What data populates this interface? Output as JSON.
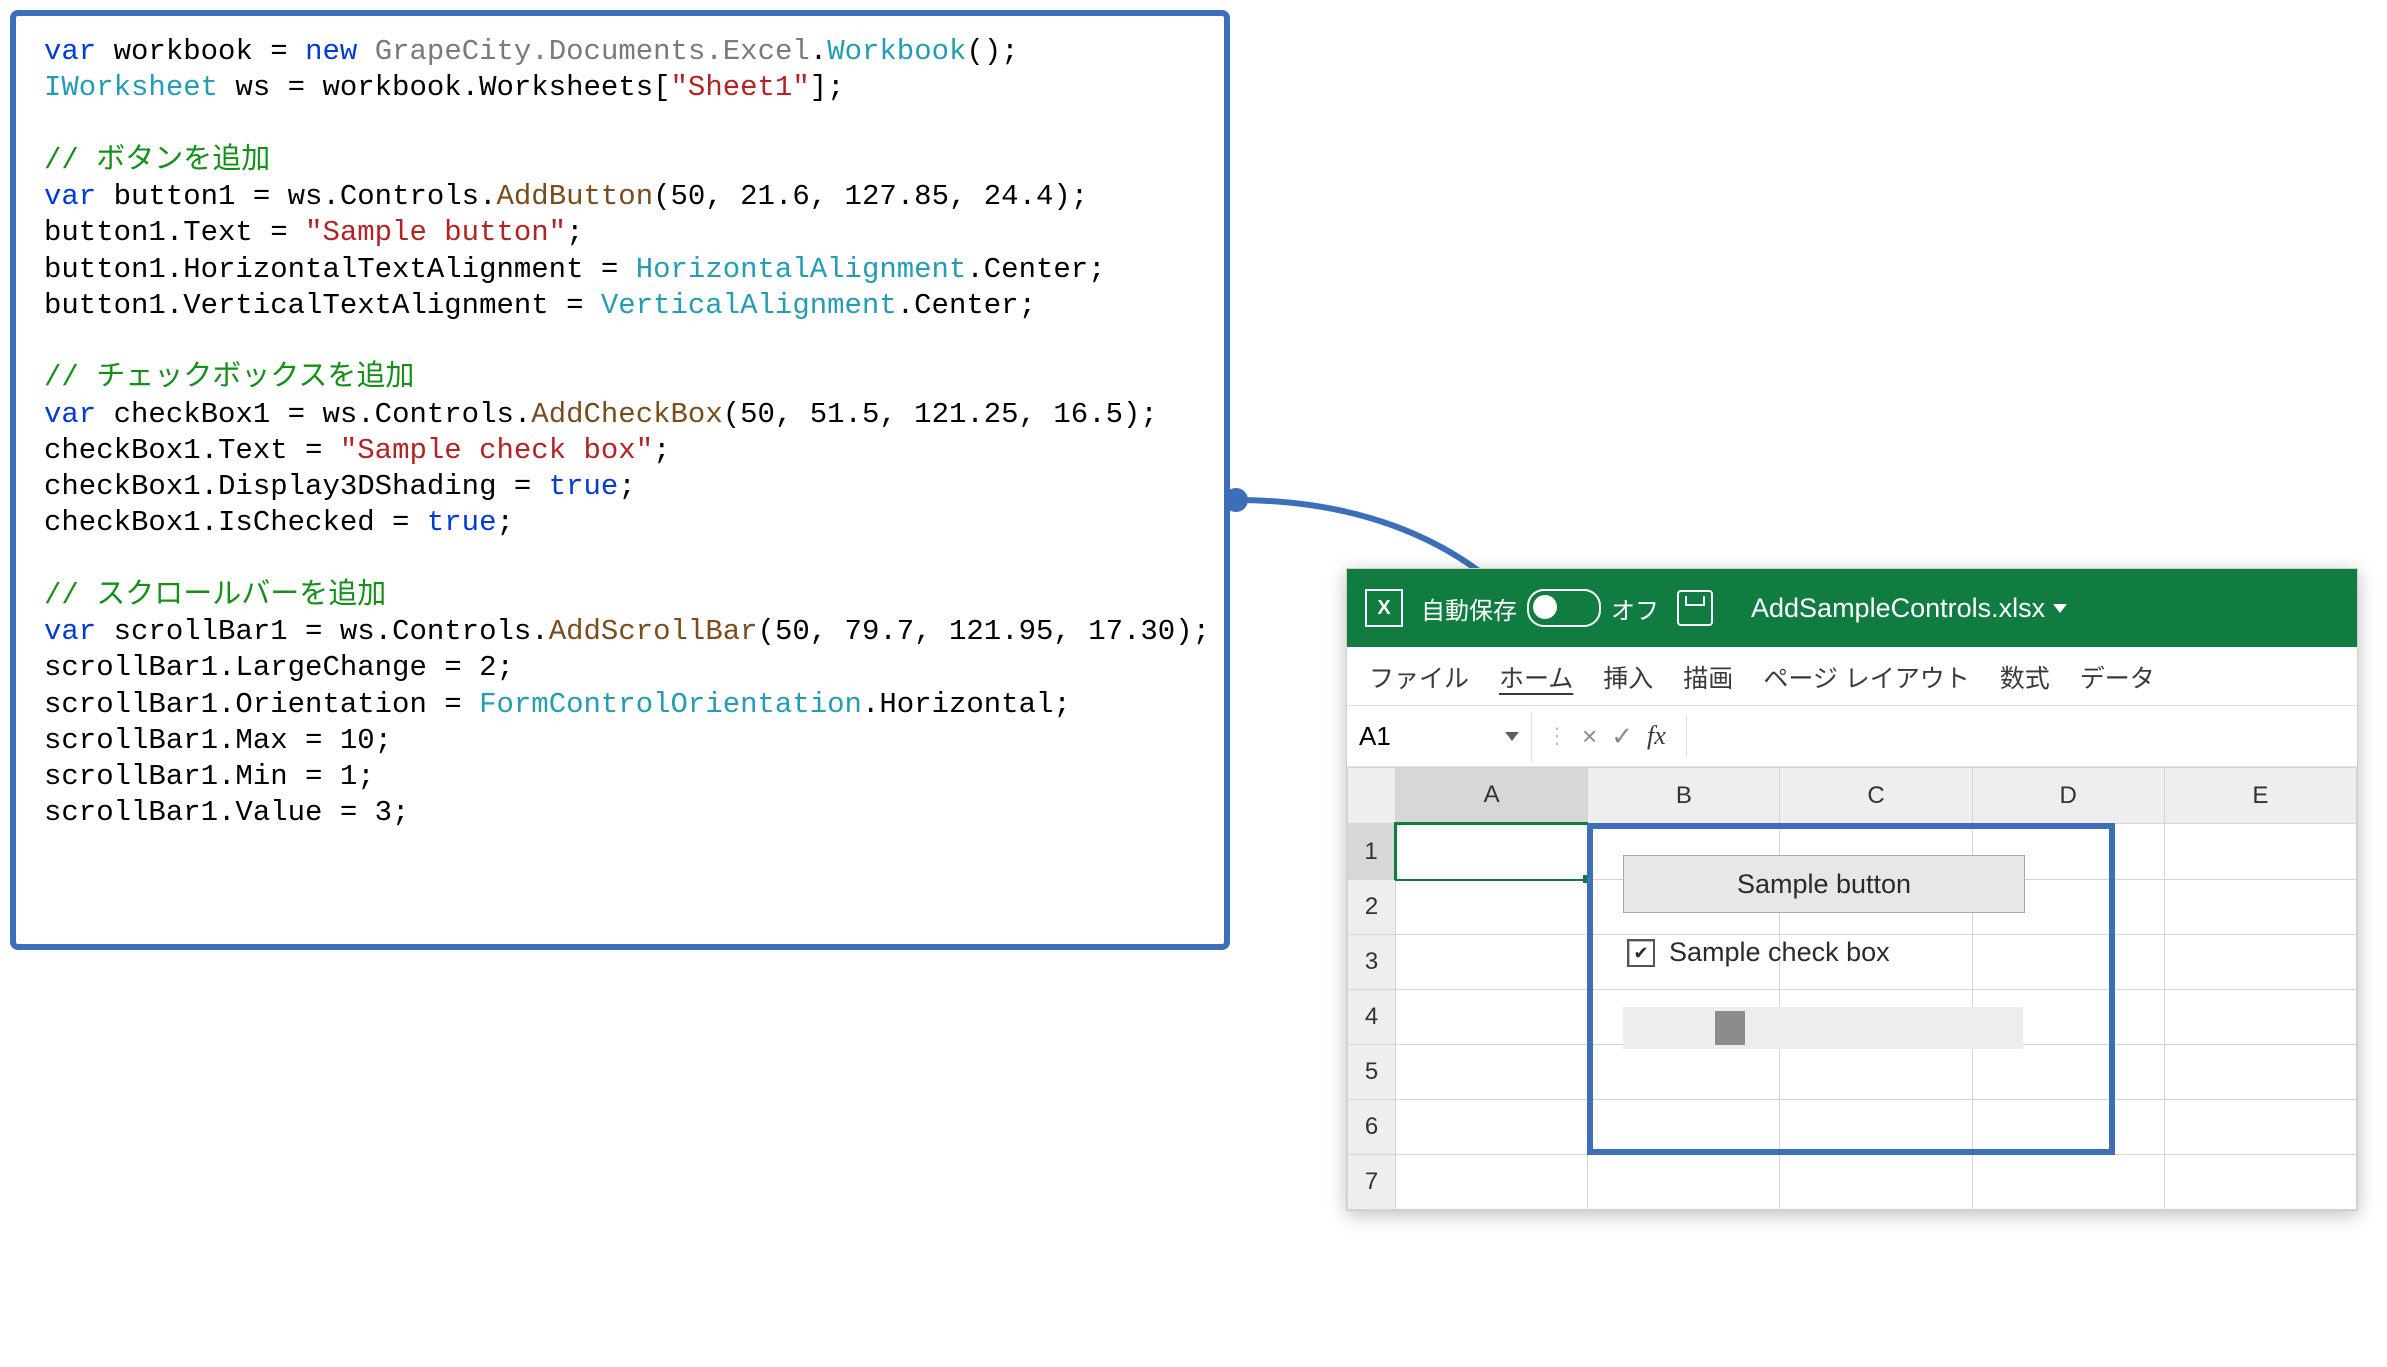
{
  "code": {
    "line1_var": "var",
    "line1_workbook": "workbook",
    "line1_eq": " = ",
    "line1_new": "new",
    "line1_ns": "GrapeCity.Documents.Excel",
    "line1_type": "Workbook",
    "line1_tail": "();",
    "line2_type": "IWorksheet",
    "line2_name": " ws = workbook.Worksheets[",
    "line2_str": "\"Sheet1\"",
    "line2_tail": "];",
    "blank": "",
    "cmt_button": "// ボタンを追加",
    "btn_var": "var",
    "btn_name": " button1 = ws.Controls.",
    "btn_method": "AddButton",
    "btn_args": "(50, 21.6, 127.85, 24.4);",
    "btn_text_lhs": "button1.Text = ",
    "btn_text_str": "\"Sample button\"",
    "btn_text_tail": ";",
    "btn_halign_lhs": "button1.HorizontalTextAlignment = ",
    "btn_halign_type": "HorizontalAlignment",
    "btn_halign_tail": ".Center;",
    "btn_valign_lhs": "button1.VerticalTextAlignment = ",
    "btn_valign_type": "VerticalAlignment",
    "btn_valign_tail": ".Center;",
    "cmt_check": "// チェックボックスを追加",
    "chk_var": "var",
    "chk_name": " checkBox1 = ws.Controls.",
    "chk_method": "AddCheckBox",
    "chk_args": "(50, 51.5, 121.25, 16.5);",
    "chk_text_lhs": "checkBox1.Text = ",
    "chk_text_str": "\"Sample check box\"",
    "chk_text_tail": ";",
    "chk_3d_lhs": "checkBox1.Display3DShading = ",
    "chk_true": "true",
    "chk_3d_tail": ";",
    "chk_checked_lhs": "checkBox1.IsChecked = ",
    "chk_checked_tail": ";",
    "cmt_scroll": "// スクロールバーを追加",
    "sb_var": "var",
    "sb_name": " scrollBar1 = ws.Controls.",
    "sb_method": "AddScrollBar",
    "sb_args": "(50, 79.7, 121.95, 17.30);",
    "sb_large": "scrollBar1.LargeChange = 2;",
    "sb_orient_lhs": "scrollBar1.Orientation = ",
    "sb_orient_type": "FormControlOrientation",
    "sb_orient_tail": ".Horizontal;",
    "sb_max": "scrollBar1.Max = 10;",
    "sb_min": "scrollBar1.Min = 1;",
    "sb_value": "scrollBar1.Value = 3;"
  },
  "excel": {
    "appicon": "X",
    "autosave_label": "自動保存",
    "autosave_state": "オフ",
    "filename": "AddSampleControls.xlsx",
    "tabs": {
      "file": "ファイル",
      "home": "ホーム",
      "insert": "挿入",
      "draw": "描画",
      "layout": "ページ レイアウト",
      "formula": "数式",
      "data": "データ"
    },
    "namebox": "A1",
    "fx_label": "fx",
    "fx_cancel": "×",
    "fx_ok": "✓",
    "columns": [
      "A",
      "B",
      "C",
      "D",
      "E"
    ],
    "rows": [
      "1",
      "2",
      "3",
      "4",
      "5",
      "6",
      "7"
    ],
    "controls": {
      "button_text": "Sample button",
      "checkbox_text": "Sample check box",
      "checkbox_checked": "✔"
    }
  }
}
